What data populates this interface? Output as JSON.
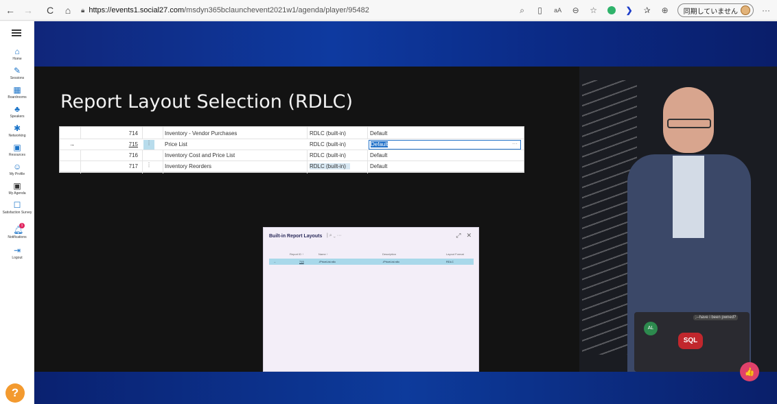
{
  "browser": {
    "back": "←",
    "forward": "→",
    "reload": "C",
    "home": "⌂",
    "url_host": "https://events1.social27.com",
    "url_path": "/msdyn365bclaunchevent2021w1/agenda/player/95482",
    "sync_label": "同期していません",
    "more": "···"
  },
  "sidebar": {
    "items": [
      {
        "label": "Home",
        "icon": "home-icon"
      },
      {
        "label": "Sessions",
        "icon": "pen-icon"
      },
      {
        "label": "Boardrooms",
        "icon": "boardroom-icon"
      },
      {
        "label": "Speakers",
        "icon": "speaker-icon"
      },
      {
        "label": "Networking",
        "icon": "networking-icon"
      },
      {
        "label": "Resources",
        "icon": "resources-icon"
      },
      {
        "label": "My Profile",
        "icon": "profile-icon"
      },
      {
        "label": "My Agenda",
        "icon": "agenda-icon"
      },
      {
        "label": "Satisfaction Survey",
        "icon": "survey-icon"
      },
      {
        "label": "Notifications",
        "icon": "bell-icon",
        "badge": "1"
      },
      {
        "label": "Logout",
        "icon": "logout-icon"
      }
    ],
    "help": "?"
  },
  "slide": {
    "title": "Report Layout Selection (RDLC)",
    "rows": [
      {
        "arrow": "",
        "id": "714",
        "name": "Inventory - Vendor Purchases",
        "layout": "RDLC (built-in)",
        "format": "Default"
      },
      {
        "arrow": "→",
        "id": "715",
        "name": "Price List",
        "layout": "RDLC (built-in)",
        "format": "Default"
      },
      {
        "arrow": "",
        "id": "716",
        "name": "Inventory Cost and Price List",
        "layout": "RDLC (built-in)",
        "format": "Default"
      },
      {
        "arrow": "",
        "id": "717",
        "name": "Inventory Reorders",
        "layout": "RDLC (built-in)",
        "format": "Default"
      }
    ],
    "edit_more": "···",
    "dots": "⋮"
  },
  "dialog": {
    "title": "Built-in Report Layouts",
    "tools": "| ⌕ ⌄   ···",
    "expand": "⤢",
    "close": "✕",
    "headers": [
      "Report ID ↑",
      "Name ↑",
      "Description",
      "Layout Format"
    ],
    "row": {
      "arrow": "→",
      "id": "715",
      "name": "./PriceList.rdlc",
      "description": "./PriceList.rdlc",
      "format": "RDLC"
    }
  },
  "presenter": {
    "laptop_logo": "SQL",
    "sticker_al": "AL",
    "sticker_pwned": ";--have i been pwned?"
  },
  "like_icon": "👍"
}
